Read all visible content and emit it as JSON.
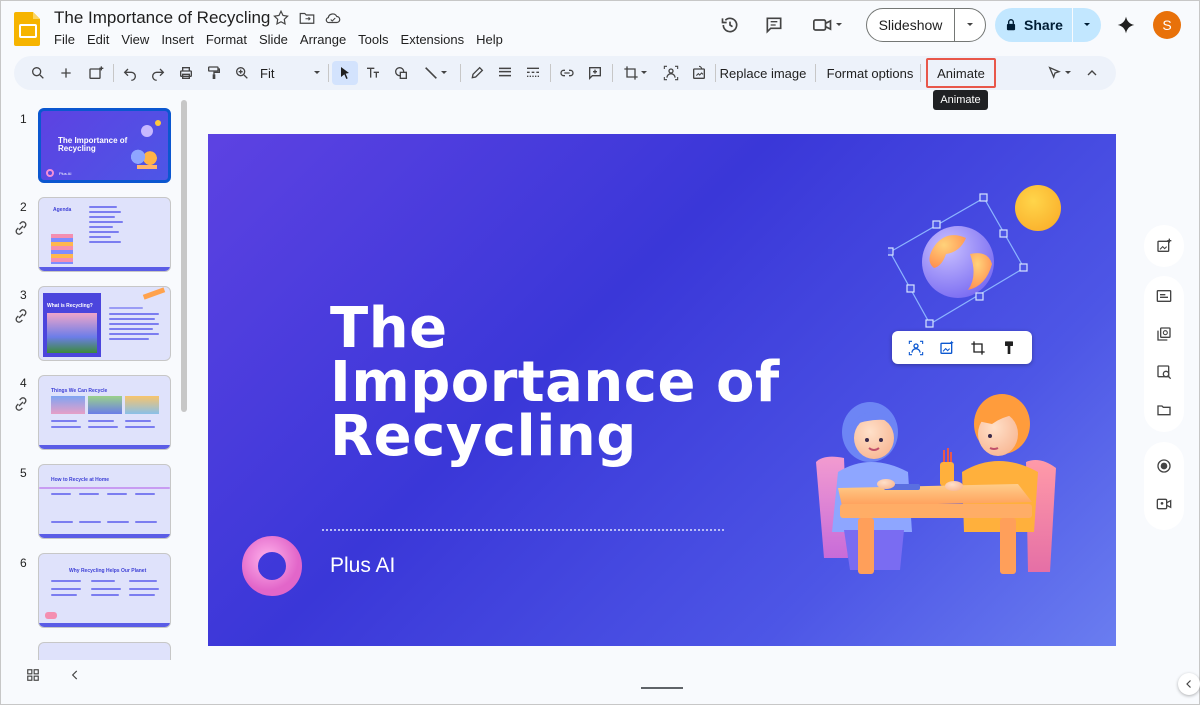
{
  "document": {
    "title": "The Importance of Recycling"
  },
  "menu": [
    "File",
    "Edit",
    "View",
    "Insert",
    "Format",
    "Slide",
    "Arrange",
    "Tools",
    "Extensions",
    "Help"
  ],
  "header": {
    "slideshow_label": "Slideshow",
    "share_label": "Share",
    "avatar_letter": "S"
  },
  "toolbar": {
    "zoom_value": "Fit",
    "replace_image_label": "Replace image",
    "format_options_label": "Format options",
    "animate_label": "Animate",
    "tooltip": "Animate"
  },
  "filmstrip": {
    "slides": [
      {
        "number": "1",
        "title": "The Importance of Recycling",
        "footer": "Plus AI"
      },
      {
        "number": "2",
        "title": "Agenda"
      },
      {
        "number": "3",
        "title": "What is Recycling?"
      },
      {
        "number": "4",
        "title": "Things We Can Recycle"
      },
      {
        "number": "5",
        "title": "How to Recycle at Home"
      },
      {
        "number": "6",
        "title": "Why Recycling Helps Our Planet"
      }
    ]
  },
  "slide": {
    "title_lines": [
      "The",
      "Importance of",
      "Recycling"
    ],
    "subtitle": "Plus AI"
  },
  "colors": {
    "accent": "#0b57d0",
    "share_bg": "#c2e7ff",
    "avatar": "#e8710a",
    "highlight": "#e8574a",
    "slide_bg": "#3a37d8"
  }
}
